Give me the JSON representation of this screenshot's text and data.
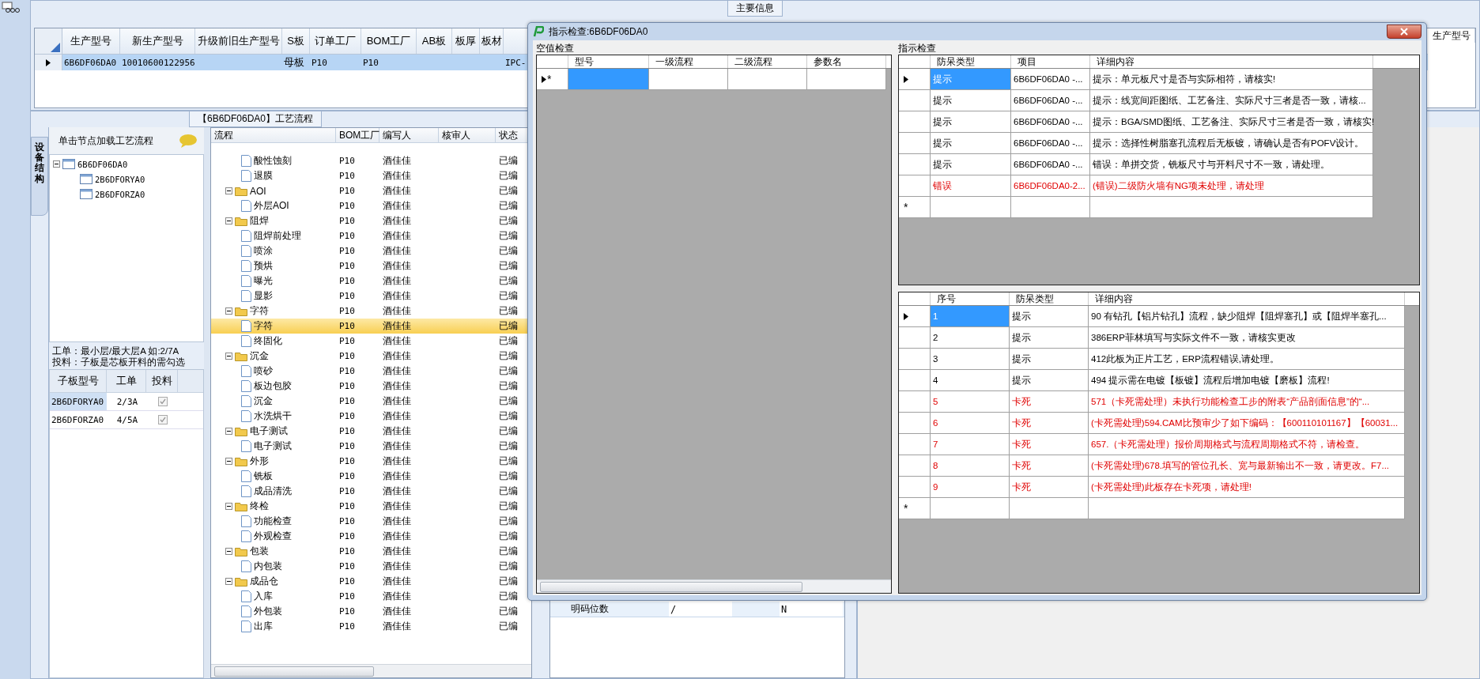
{
  "main_info": {
    "title": "主要信息",
    "columns": [
      "生产型号",
      "新生产型号",
      "升级前旧生产型号",
      "S板",
      "订单工厂",
      "BOM工厂",
      "AB板",
      "板厚",
      "板材"
    ],
    "rows": [
      {
        "selected": true,
        "cells": [
          "6B6DF06DA0",
          "10010600122956",
          "",
          "母板",
          "P10",
          "P10",
          "",
          "",
          "",
          "IPC-"
        ]
      }
    ],
    "right_column": "生产型号"
  },
  "process": {
    "title": "【6B6DF06DA0】工艺流程",
    "side_tab": "设备结构",
    "tree_header": "单击节点加载工艺流程",
    "structure_tree": [
      {
        "label": "6B6DF06DA0",
        "expanded": true,
        "children": [
          {
            "label": "2B6DFORYA0"
          },
          {
            "label": "2B6DFORZA0"
          }
        ]
      }
    ],
    "note": [
      "工单：最小层/最大层A 如:2/7A",
      "投料：子板是芯板开料的需勾选"
    ],
    "subboards": {
      "columns": [
        "子板型号",
        "工单",
        "投料"
      ],
      "rows": [
        {
          "model": "2B6DFORYA0",
          "order": "2/3A",
          "checked": true,
          "selected": true
        },
        {
          "model": "2B6DFORZA0",
          "order": "4/5A",
          "checked": true,
          "selected": false
        }
      ]
    },
    "flow": {
      "columns": [
        "流程",
        "BOM工厂",
        "编写人",
        "核审人",
        "状态"
      ],
      "rows": [
        {
          "expanded": true,
          "children": [
            {
              "label": "酸性蚀刻",
              "bom": "P10",
              "writer": "酒佳佳",
              "status": "已编",
              "selected": false
            },
            {
              "label": "退膜",
              "bom": "P10",
              "writer": "酒佳佳",
              "status": "已编",
              "selected": false
            }
          ]
        },
        {
          "label": "AOI",
          "bom": "P10",
          "writer": "酒佳佳",
          "status": "已编",
          "selected": false,
          "expanded": true,
          "children": [
            {
              "label": "外层AOI",
              "bom": "P10",
              "writer": "酒佳佳",
              "status": "已编",
              "selected": false
            }
          ]
        },
        {
          "label": "阻焊",
          "bom": "P10",
          "writer": "酒佳佳",
          "status": "已编",
          "selected": false,
          "expanded": true,
          "children": [
            {
              "label": "阻焊前处理",
              "bom": "P10",
              "writer": "酒佳佳",
              "status": "已编",
              "selected": false
            },
            {
              "label": "喷涂",
              "bom": "P10",
              "writer": "酒佳佳",
              "status": "已编",
              "selected": false
            },
            {
              "label": "预烘",
              "bom": "P10",
              "writer": "酒佳佳",
              "status": "已编",
              "selected": false
            },
            {
              "label": "曝光",
              "bom": "P10",
              "writer": "酒佳佳",
              "status": "已编",
              "selected": false
            },
            {
              "label": "显影",
              "bom": "P10",
              "writer": "酒佳佳",
              "status": "已编",
              "selected": false
            }
          ]
        },
        {
          "label": "字符",
          "bom": "P10",
          "writer": "酒佳佳",
          "status": "已编",
          "selected": false,
          "expanded": true,
          "children": [
            {
              "label": "字符",
              "bom": "P10",
              "writer": "酒佳佳",
              "status": "已编",
              "selected": true
            },
            {
              "label": "终固化",
              "bom": "P10",
              "writer": "酒佳佳",
              "status": "已编",
              "selected": false
            }
          ]
        },
        {
          "label": "沉金",
          "bom": "P10",
          "writer": "酒佳佳",
          "status": "已编",
          "selected": false,
          "expanded": true,
          "children": [
            {
              "label": "喷砂",
              "bom": "P10",
              "writer": "酒佳佳",
              "status": "已编",
              "selected": false
            },
            {
              "label": "板边包胶",
              "bom": "P10",
              "writer": "酒佳佳",
              "status": "已编",
              "selected": false
            },
            {
              "label": "沉金",
              "bom": "P10",
              "writer": "酒佳佳",
              "status": "已编",
              "selected": false
            },
            {
              "label": "水洗烘干",
              "bom": "P10",
              "writer": "酒佳佳",
              "status": "已编",
              "selected": false
            }
          ]
        },
        {
          "label": "电子测试",
          "bom": "P10",
          "writer": "酒佳佳",
          "status": "已编",
          "selected": false,
          "expanded": true,
          "children": [
            {
              "label": "电子测试",
              "bom": "P10",
              "writer": "酒佳佳",
              "status": "已编",
              "selected": false
            }
          ]
        },
        {
          "label": "外形",
          "bom": "P10",
          "writer": "酒佳佳",
          "status": "已编",
          "selected": false,
          "expanded": true,
          "children": [
            {
              "label": "铣板",
              "bom": "P10",
              "writer": "酒佳佳",
              "status": "已编",
              "selected": false
            },
            {
              "label": "成品清洗",
              "bom": "P10",
              "writer": "酒佳佳",
              "status": "已编",
              "selected": false
            }
          ]
        },
        {
          "label": "终检",
          "bom": "P10",
          "writer": "酒佳佳",
          "status": "已编",
          "selected": false,
          "expanded": true,
          "children": [
            {
              "label": "功能检查",
              "bom": "P10",
              "writer": "酒佳佳",
              "status": "已编",
              "selected": false
            },
            {
              "label": "外观检查",
              "bom": "P10",
              "writer": "酒佳佳",
              "status": "已编",
              "selected": false
            }
          ]
        },
        {
          "label": "包装",
          "bom": "P10",
          "writer": "酒佳佳",
          "status": "已编",
          "selected": false,
          "expanded": true,
          "children": [
            {
              "label": "内包装",
              "bom": "P10",
              "writer": "酒佳佳",
              "status": "已编",
              "selected": false
            }
          ]
        },
        {
          "label": "成品仓",
          "bom": "P10",
          "writer": "酒佳佳",
          "status": "已编",
          "selected": false,
          "expanded": true,
          "children": [
            {
              "label": "入库",
              "bom": "P10",
              "writer": "酒佳佳",
              "status": "已编",
              "selected": false
            },
            {
              "label": "外包装",
              "bom": "P10",
              "writer": "酒佳佳",
              "status": "已编",
              "selected": false
            },
            {
              "label": "出库",
              "bom": "P10",
              "writer": "酒佳佳",
              "status": "已编",
              "selected": false
            }
          ]
        }
      ]
    }
  },
  "params": {
    "rows": [
      {
        "cells": [
          "明码位数",
          "/",
          "",
          "N"
        ]
      }
    ]
  },
  "dialog": {
    "title": "指示检查:6B6DF06DA0",
    "empty_check": {
      "title": "空值检查",
      "columns": [
        "型号",
        "一级流程",
        "二级流程",
        "参数名"
      ],
      "new_row_mark": "*"
    },
    "indication": {
      "title": "指示检查",
      "top": {
        "columns": [
          "防呆类型",
          "项目",
          "详细内容"
        ],
        "new_row_mark": "*",
        "rows": [
          {
            "kind": "hint",
            "selected": true,
            "cells": [
              "提示",
              "6B6DF06DA0 -...",
              "提示：单元板尺寸是否与实际相符，请核实!"
            ]
          },
          {
            "kind": "hint",
            "selected": false,
            "cells": [
              "提示",
              "6B6DF06DA0 -...",
              "提示：线宽间距图纸、工艺备注、实际尺寸三者是否一致，请核..."
            ]
          },
          {
            "kind": "hint",
            "selected": false,
            "cells": [
              "提示",
              "6B6DF06DA0 -...",
              "提示：BGA/SMD图纸、工艺备注、实际尺寸三者是否一致，请核实!"
            ]
          },
          {
            "kind": "hint",
            "selected": false,
            "cells": [
              "提示",
              "6B6DF06DA0 -...",
              "提示：选择性树脂塞孔流程后无板镀，请确认是否有POFV设计。"
            ]
          },
          {
            "kind": "hint",
            "selected": false,
            "cells": [
              "提示",
              "6B6DF06DA0 -...",
              "错误：单拼交货，铣板尺寸与开料尺寸不一致，请处理。"
            ]
          },
          {
            "kind": "error",
            "selected": false,
            "cells": [
              "错误",
              "6B6DF06DA0-2...",
              "(错误)二级防火墙有NG项未处理，请处理"
            ]
          }
        ]
      },
      "bottom": {
        "columns": [
          "序号",
          "防呆类型",
          "详细内容"
        ],
        "new_row_mark": "*",
        "rows": [
          {
            "kind": "hint",
            "selected": true,
            "cells": [
              "1",
              "提示",
              "90 有钻孔【铝片钻孔】流程，缺少阻焊【阻焊塞孔】或【阻焊半塞孔..."
            ]
          },
          {
            "kind": "hint",
            "selected": false,
            "cells": [
              "2",
              "提示",
              "386ERP菲林填写与实际文件不一致，请核实更改"
            ]
          },
          {
            "kind": "hint",
            "selected": false,
            "cells": [
              "3",
              "提示",
              "412此板为正片工艺，ERP流程错误,请处理。"
            ]
          },
          {
            "kind": "hint",
            "selected": false,
            "cells": [
              "4",
              "提示",
              "494 提示需在电镀【板镀】流程后增加电镀【磨板】流程!"
            ]
          },
          {
            "kind": "error",
            "selected": false,
            "cells": [
              "5",
              "卡死",
              "571（卡死需处理）未执行功能检查工步的附表“产品剖面信息”的“..."
            ]
          },
          {
            "kind": "error",
            "selected": false,
            "cells": [
              "6",
              "卡死",
              "(卡死需处理)594.CAM比预审少了如下编码：【600110101167】【60031..."
            ]
          },
          {
            "kind": "error",
            "selected": false,
            "cells": [
              "7",
              "卡死",
              "657.（卡死需处理）报价周期格式与流程周期格式不符，请检查。"
            ]
          },
          {
            "kind": "error",
            "selected": false,
            "cells": [
              "8",
              "卡死",
              "(卡死需处理)678.填写的管位孔长、宽与最新输出不一致，请更改。F7..."
            ]
          },
          {
            "kind": "error",
            "selected": false,
            "cells": [
              "9",
              "卡死",
              "(卡死需处理)此板存在卡死项，请处理!"
            ]
          }
        ]
      }
    }
  }
}
